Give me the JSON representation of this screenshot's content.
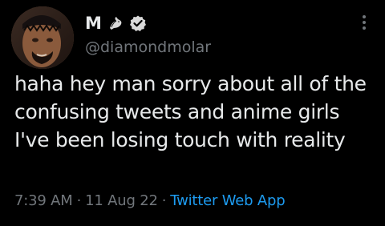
{
  "author": {
    "display_name": "M",
    "handle": "@diamondmolar",
    "avatar_icon": "profile-photo",
    "dove_icon": "dove-icon",
    "verified_icon": "verified-badge-icon",
    "verified_color": "#d9d9d9"
  },
  "tweet": {
    "text": "haha hey man sorry about all of the confusing tweets and anime girls I've been losing touch with reality"
  },
  "meta": {
    "time": "7:39 AM",
    "separator": "·",
    "date": "11 Aug 22",
    "source": "Twitter Web App"
  },
  "menu": {
    "icon": "more-options-icon"
  },
  "colors": {
    "background": "#000000",
    "text": "#e7e9ea",
    "secondary": "#71767b",
    "link": "#1d9bf0"
  }
}
